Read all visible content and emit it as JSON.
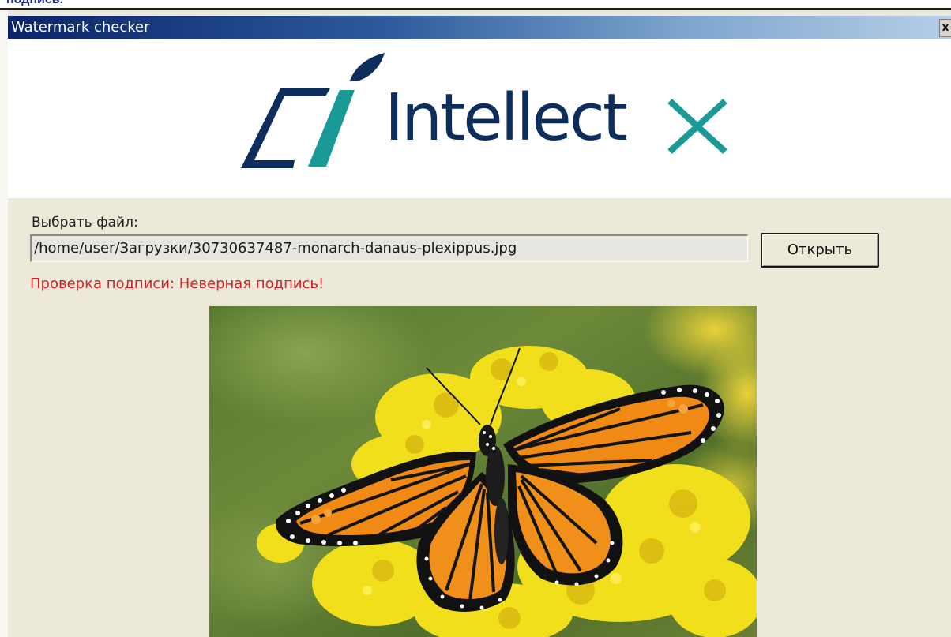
{
  "window": {
    "above_caption": "подпись.",
    "title": "Watermark checker",
    "close_label": "x"
  },
  "logo": {
    "wordmark": "Intellect",
    "x_letter": "X"
  },
  "file_picker": {
    "label": "Выбрать файл:",
    "path": "/home/user/Загрузки/30730637487-monarch-danaus-plexippus.jpg",
    "open_button": "Открыть"
  },
  "status": {
    "message": "Проверка подписи: Неверная подпись!",
    "color": "#d6202a"
  },
  "preview": {
    "subject": "monarch-butterfly-image"
  },
  "colors": {
    "titlebar_start": "#0b2469",
    "titlebar_end": "#b6cee6",
    "logo_navy": "#0d2d5c",
    "logo_teal": "#1a9a97",
    "window_bg": "#ece9d8"
  }
}
